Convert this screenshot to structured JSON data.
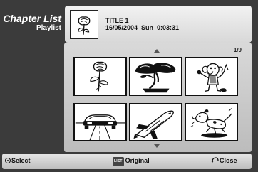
{
  "header": {
    "title": "Chapter List",
    "subtitle": "Playlist"
  },
  "info": {
    "title_line": "TITLE 1",
    "date_line": "16/05/2004  Sun  0:03:31",
    "thumb_icon": "rose-icon"
  },
  "grid": {
    "page_counter": "1/9",
    "thumbnails": [
      {
        "icon": "rose-icon"
      },
      {
        "icon": "bonsai-tree-icon"
      },
      {
        "icon": "cartoon-elephant-icon"
      },
      {
        "icon": "car-road-icon"
      },
      {
        "icon": "space-shuttle-icon"
      },
      {
        "icon": "cartoon-dog-icon"
      }
    ]
  },
  "footer": {
    "select_label": "Select",
    "list_key": "LIST",
    "original_label": "Original",
    "close_label": "Close"
  },
  "colors": {
    "background": "#3b3b3b",
    "panel": "#d9d9d9",
    "text_light": "#ffffff",
    "text_dark": "#111111"
  }
}
